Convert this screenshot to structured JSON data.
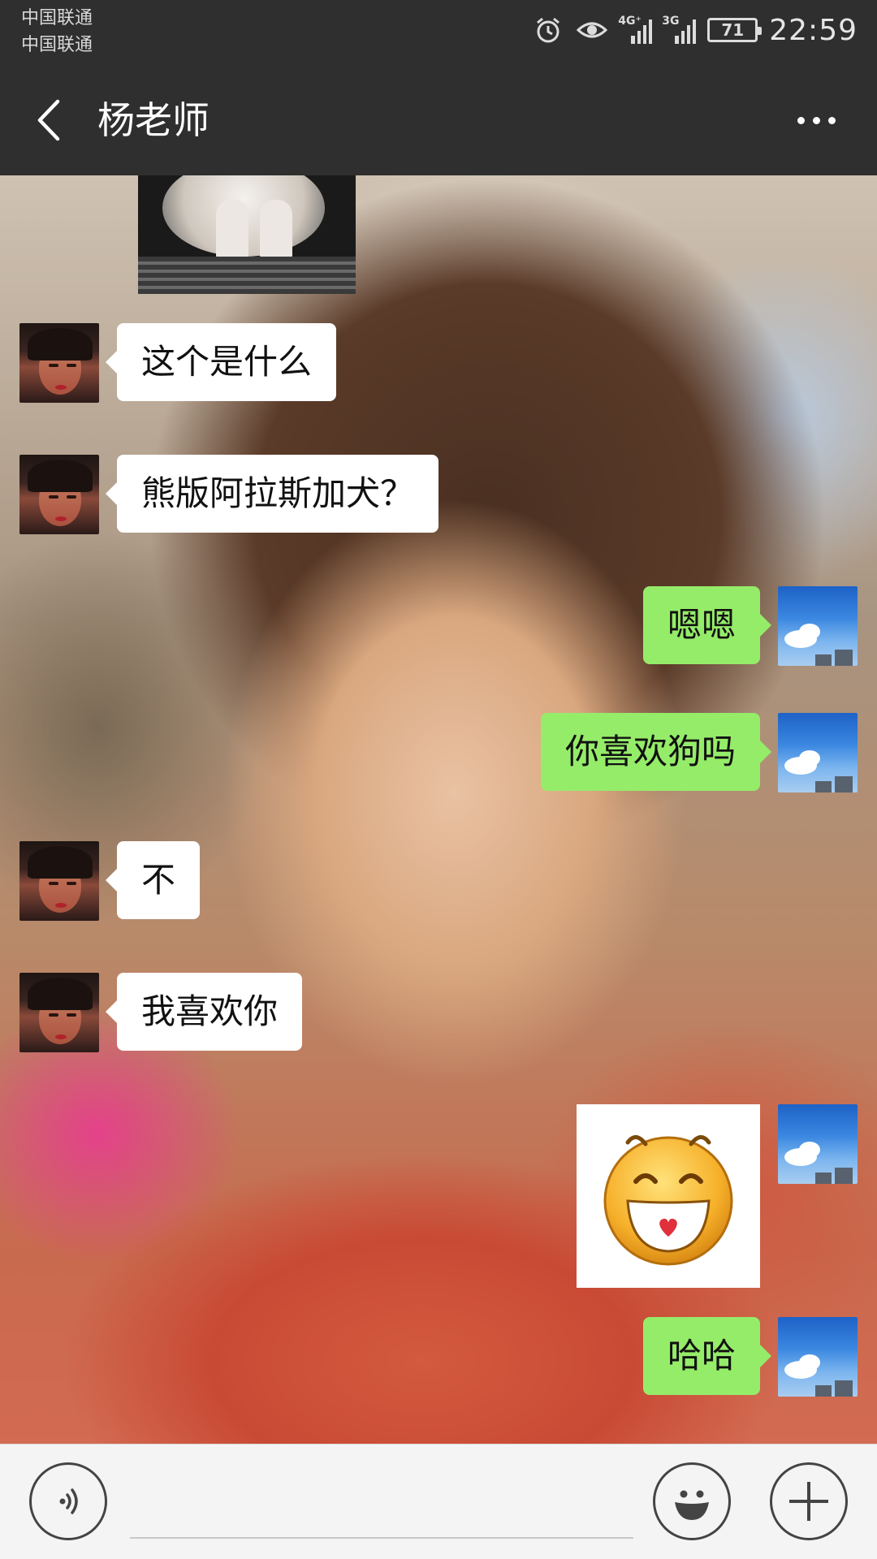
{
  "status_bar": {
    "carrier_1": "中国联通",
    "carrier_2": "中国联通",
    "icons": [
      "alarm-icon",
      "eye-icon"
    ],
    "signal_1_label": "4G⁺",
    "signal_2_label": "3G",
    "battery_level": "71",
    "time": "22:59"
  },
  "nav": {
    "title": "杨老师",
    "back_icon": "chevron-left-icon",
    "more_icon": "more-dots-icon"
  },
  "messages": [
    {
      "side": "left",
      "type": "image",
      "avatar": "girl-avatar"
    },
    {
      "side": "left",
      "type": "text",
      "text": "这个是什么"
    },
    {
      "side": "left",
      "type": "text",
      "text": "熊版阿拉斯加犬？"
    },
    {
      "side": "right",
      "type": "text",
      "text": "嗯嗯"
    },
    {
      "side": "right",
      "type": "text",
      "text": "你喜欢狗吗"
    },
    {
      "side": "left",
      "type": "text",
      "text": "不"
    },
    {
      "side": "left",
      "type": "text",
      "text": "我喜欢你"
    },
    {
      "side": "right",
      "type": "sticker",
      "sticker": "laughing-face-sticker"
    },
    {
      "side": "right",
      "type": "text",
      "text": "哈哈"
    }
  ],
  "input_bar": {
    "voice_icon": "voice-icon",
    "emoji_icon": "emoji-icon",
    "plus_icon": "plus-icon",
    "input_value": ""
  },
  "colors": {
    "header_bg": "#2f2f2f",
    "bubble_right": "#95ec69",
    "bubble_left": "#ffffff",
    "input_bar_bg": "#f4f4f4"
  }
}
